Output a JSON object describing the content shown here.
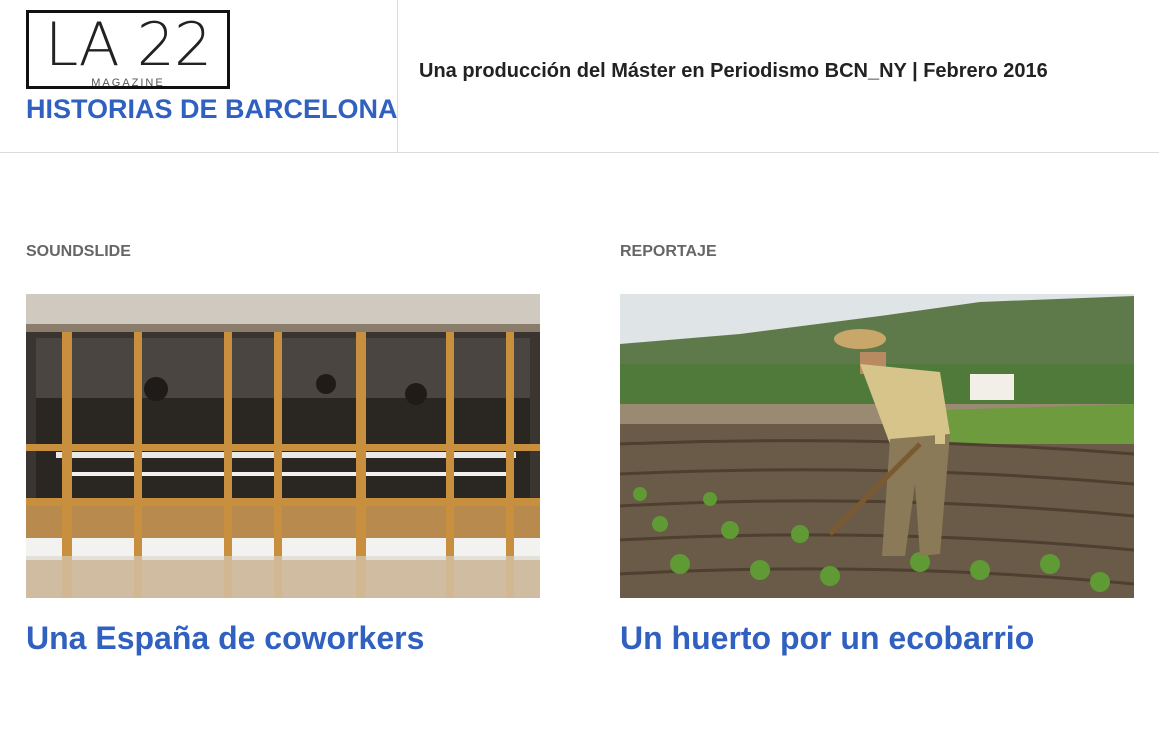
{
  "header": {
    "logo_text": "LA 22",
    "logo_subtext": "MAGAZINE",
    "site_title": "HISTORIAS DE BARCELONA",
    "tagline": "Una producción del Máster en Periodismo BCN_NY | Febrero 2016"
  },
  "colors": {
    "accent": "#3060c0",
    "category": "#666666",
    "divider": "#dcdcdc"
  },
  "articles": [
    {
      "category": "SOUNDSLIDE",
      "title": "Una España de coworkers",
      "image": "coworking-office-photo"
    },
    {
      "category": "REPORTAJE",
      "title": "Un huerto por un ecobarrio",
      "image": "farmer-in-field-photo"
    }
  ]
}
